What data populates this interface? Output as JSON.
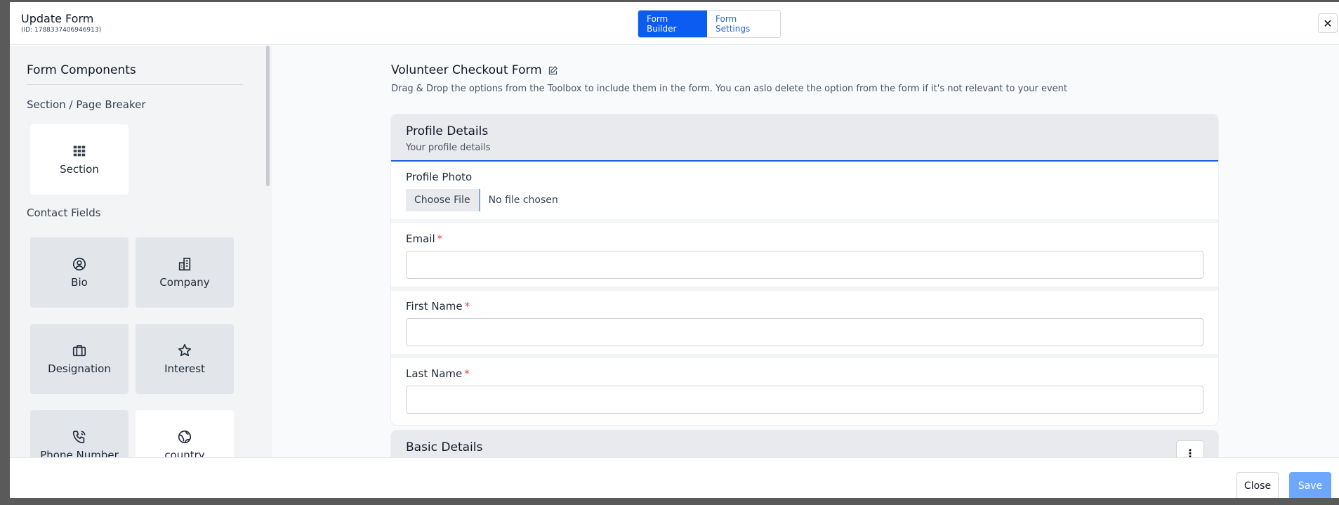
{
  "header": {
    "title": "Update Form",
    "form_id": "(ID: 1788337406946913)",
    "tabs": [
      {
        "label": "Form Builder",
        "active": true
      },
      {
        "label": "Form Settings",
        "active": false
      }
    ],
    "close_icon": "close-icon"
  },
  "sidebar": {
    "title": "Form Components",
    "groups": [
      {
        "label": "Section / Page Breaker",
        "items": [
          {
            "label": "Section",
            "icon": "grid-icon"
          }
        ]
      },
      {
        "label": "Contact Fields",
        "items": [
          {
            "label": "Bio",
            "icon": "user-circle-icon"
          },
          {
            "label": "Company",
            "icon": "building-icon"
          },
          {
            "label": "Designation",
            "icon": "briefcase-icon"
          },
          {
            "label": "Interest",
            "icon": "star-icon"
          },
          {
            "label": "Phone Number",
            "icon": "phone-icon"
          },
          {
            "label": "country",
            "icon": "globe-icon"
          }
        ]
      }
    ]
  },
  "main": {
    "form_title": "Volunteer Checkout Form",
    "edit_icon": "edit-icon",
    "description": "Drag & Drop the options from the Toolbox to include them in the form. You can aslo delete the option from the form if it's not relevant to your event",
    "sections": [
      {
        "title": "Profile Details",
        "subtitle": "Your profile details",
        "fields": [
          {
            "label": "Profile Photo",
            "type": "file",
            "button": "Choose File",
            "status": "No file chosen"
          },
          {
            "label": "Email",
            "required": true,
            "value": ""
          },
          {
            "label": "First Name",
            "required": true,
            "value": ""
          },
          {
            "label": "Last Name",
            "required": true,
            "value": ""
          }
        ]
      },
      {
        "title": "Basic Details",
        "menu_icon": "more-vertical-icon"
      }
    ]
  },
  "footer": {
    "close_label": "Close",
    "save_label": "Save"
  },
  "colors": {
    "primary": "#0d5cf2",
    "save_disabled": "#6ea8fe",
    "required": "#ef4444",
    "section_accent": "#1d5fd6"
  }
}
